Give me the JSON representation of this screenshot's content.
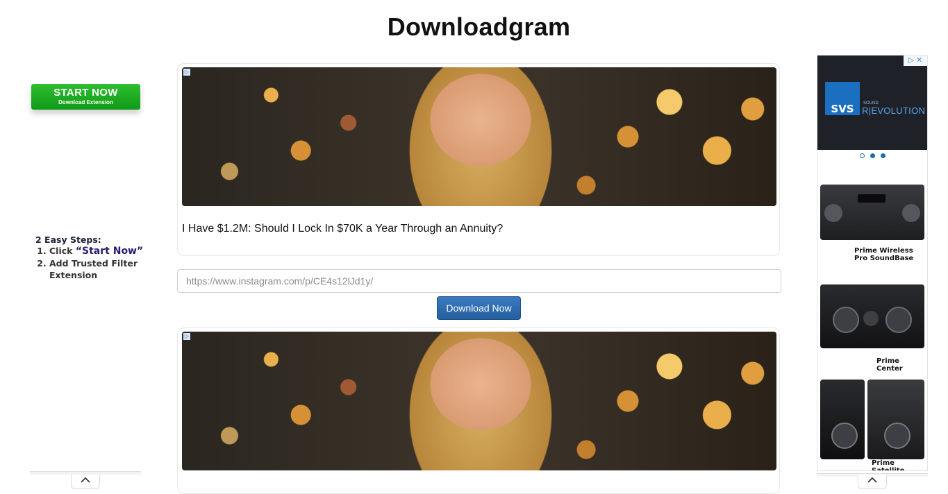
{
  "header": {
    "title": "Downloadgram"
  },
  "left_ad": {
    "start_title": "START NOW",
    "start_sub": "Download Extension",
    "steps_title": "2 Easy Steps:",
    "step1_prefix": "Click ",
    "step1_accent": "“Start Now”",
    "step2": "Add Trusted Filter Extension"
  },
  "ad_top": {
    "headline": "I Have $1.2M: Should I Lock In $70K a Year Through an Annuity?"
  },
  "form": {
    "url_placeholder": "https://www.instagram.com/p/CE4s12lJd1y/",
    "download_label": "Download Now"
  },
  "right_ad": {
    "brand_sound": "SOUND",
    "brand_revolution": "R|EVOLUTION",
    "brand_logo": "SVS",
    "carousel_active": 2,
    "products": [
      {
        "name": "Prime Wireless Pro SoundBase"
      },
      {
        "name": "Prime Center"
      },
      {
        "name": "Prime Satellite"
      }
    ]
  }
}
